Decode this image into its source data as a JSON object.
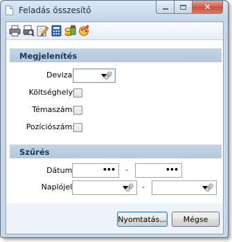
{
  "window": {
    "title": "Feladás összesítő",
    "close_glyph": "✕"
  },
  "toolbar": {
    "icons": [
      "print-icon",
      "print-preview-icon",
      "edit-icon",
      "calculator-icon",
      "stack-icon",
      "palette-icon"
    ]
  },
  "sections": {
    "display": {
      "title": "Megjelenítés",
      "currency_label": "Deviza:",
      "cost_center_label": "Költséghely:",
      "subject_label": "Témaszám:",
      "position_label": "Pozíciószám:"
    },
    "filter": {
      "title": "Szűrés",
      "date_label": "Dátum:",
      "date_separator": "-",
      "journal_label": "Naplójel:",
      "journal_separator": "-"
    }
  },
  "buttons": {
    "print": "Nyomtatás...",
    "cancel": "Mégse"
  }
}
